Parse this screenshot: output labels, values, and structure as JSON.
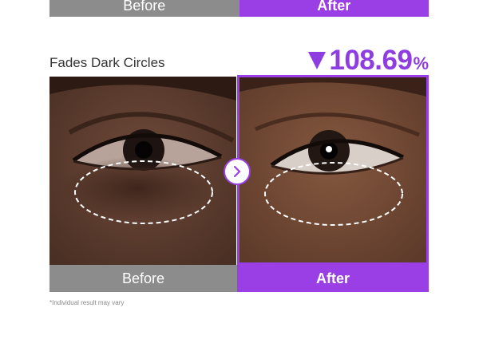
{
  "top_bar": {
    "before_label": "Before",
    "after_label": "After"
  },
  "section": {
    "title": "Fades Dark Circles",
    "stat_value": "108.69",
    "stat_unit": "%"
  },
  "labels": {
    "before": "Before",
    "after": "After"
  },
  "disclaimer": "*Individual result may vary",
  "colors": {
    "accent": "#9a3fe6",
    "before_gray": "#8c8c8c"
  },
  "icons": {
    "compare": "chevron-right-icon",
    "decrease": "triangle-down-icon"
  }
}
